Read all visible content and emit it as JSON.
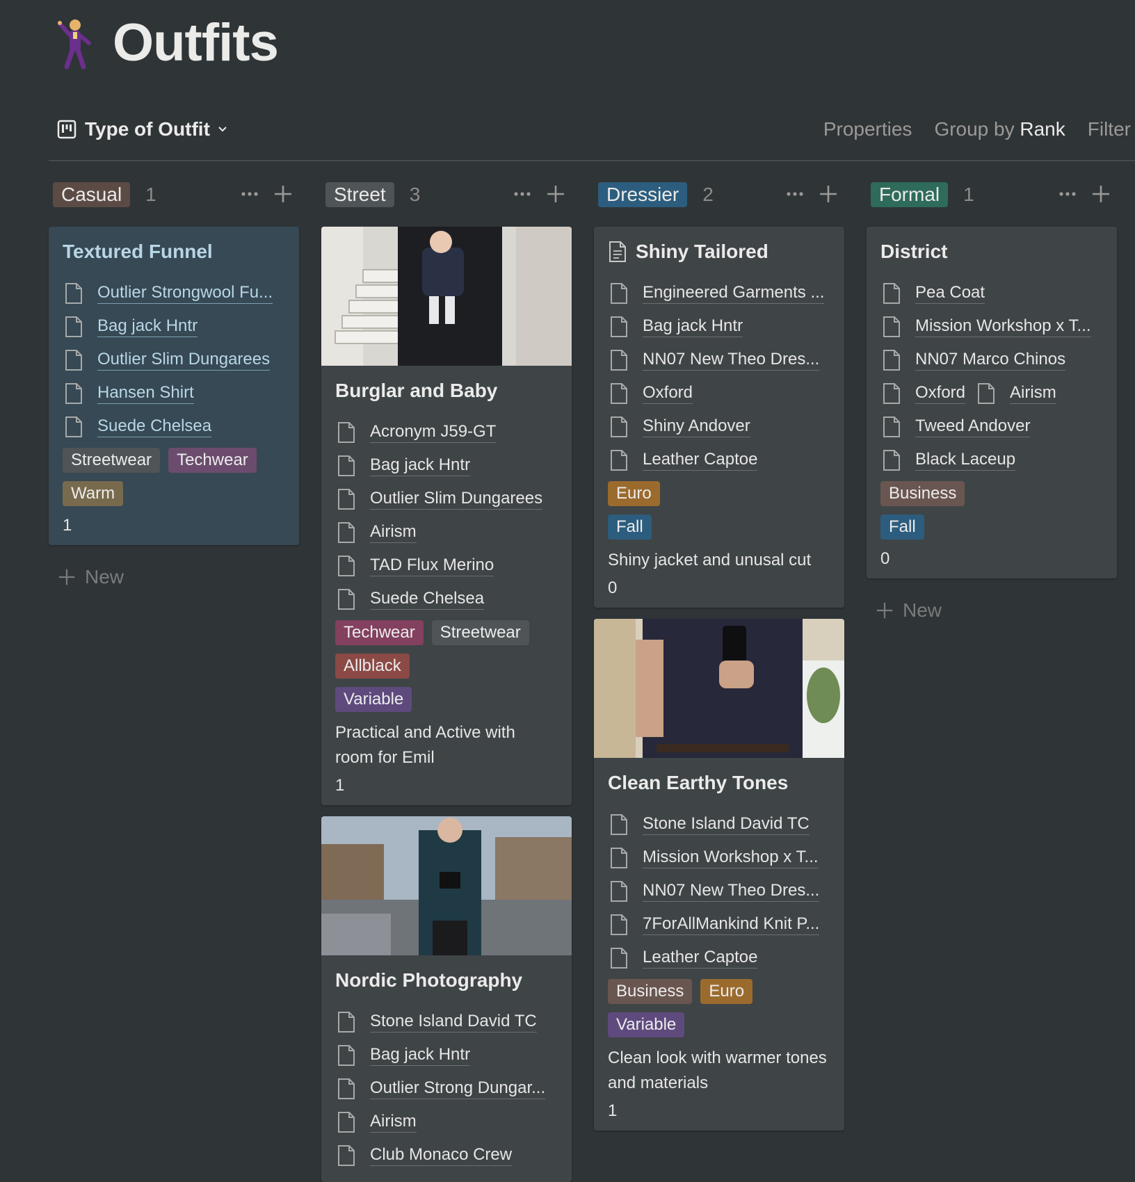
{
  "page": {
    "title": "Outfits",
    "icon": "dancer-emoji"
  },
  "toolbar": {
    "view_name": "Type of Outfit",
    "properties": "Properties",
    "group_by": "Group by",
    "group_by_value": "Rank",
    "filter": "Filter"
  },
  "new_label": "New",
  "columns": [
    {
      "label": "Casual",
      "count": "1",
      "color": "#5c4b44",
      "cards": [
        {
          "title": "Textured Funnel",
          "highlight": true,
          "items": [
            "Outlier Strongwool Fu...",
            "Bag jack Hntr",
            "Outlier Slim Dungarees",
            "Hansen Shirt",
            "Suede Chelsea"
          ],
          "tags": [
            [
              "Streetwear",
              "#4f5457"
            ],
            [
              "Techwear",
              "#6b4c6e"
            ]
          ],
          "tags2": [
            [
              "Warm",
              "#786a4d"
            ]
          ],
          "number": "1"
        }
      ]
    },
    {
      "label": "Street",
      "count": "3",
      "color": "#4f5457",
      "cards": [
        {
          "title": "Burglar and Baby",
          "cover": "stairs",
          "items": [
            "Acronym J59-GT",
            "Bag jack Hntr",
            "Outlier Slim Dungarees",
            "Airism",
            "TAD Flux Merino",
            "Suede Chelsea"
          ],
          "tags": [
            [
              "Techwear",
              "#83405f"
            ],
            [
              "Streetwear",
              "#4f5457"
            ]
          ],
          "tags2": [
            [
              "Allblack",
              "#8b4a45"
            ]
          ],
          "tags3": [
            [
              "Variable",
              "#5f4a7e"
            ]
          ],
          "text": "Practical and Active with room for Emil",
          "number": "1"
        },
        {
          "title": "Nordic Photography",
          "cover": "street",
          "items": [
            "Stone Island David TC",
            "Bag jack Hntr",
            "Outlier Strong Dungar...",
            "Airism",
            "Club Monaco Crew"
          ]
        }
      ]
    },
    {
      "label": "Dressier",
      "count": "2",
      "color": "#2c5d7e",
      "cards": [
        {
          "title": "Shiny Tailored",
          "title_icon": true,
          "items": [
            "Engineered Garments ...",
            "Bag jack Hntr",
            "NN07 New Theo Dres...",
            "Oxford",
            "Shiny Andover",
            "Leather Captoe"
          ],
          "tags": [
            [
              "Euro",
              "#9b6b2e"
            ]
          ],
          "tags2": [
            [
              "Fall",
              "#2c5d7e"
            ]
          ],
          "text": "Shiny jacket and unusal cut",
          "number": "0"
        },
        {
          "title": "Clean Earthy Tones",
          "cover": "mirror",
          "items": [
            "Stone Island David TC",
            "Mission Workshop x T...",
            "NN07 New Theo Dres...",
            "7ForAllMankind Knit P...",
            "Leather Captoe"
          ],
          "tags": [
            [
              "Business",
              "#6a5650"
            ],
            [
              "Euro",
              "#9b6b2e"
            ]
          ],
          "tags2": [
            [
              "Variable",
              "#5f4a7e"
            ]
          ],
          "text": "Clean look with warmer tones and materials",
          "number": "1"
        }
      ]
    },
    {
      "label": "Formal",
      "count": "1",
      "color": "#2f6b5a",
      "cards": [
        {
          "title": "District",
          "items": [
            "Pea Coat",
            "Mission Workshop x T...",
            "NN07 Marco Chinos"
          ],
          "pair": [
            "Oxford",
            "Airism"
          ],
          "items2": [
            "Tweed Andover",
            "Black Laceup"
          ],
          "tags": [
            [
              "Business",
              "#6a5650"
            ]
          ],
          "tags2": [
            [
              "Fall",
              "#2c5d7e"
            ]
          ],
          "number": "0"
        }
      ]
    }
  ]
}
